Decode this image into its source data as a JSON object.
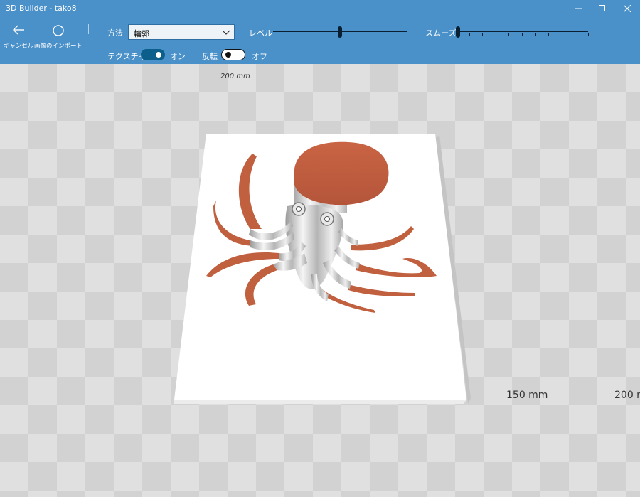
{
  "window": {
    "title": "3D Builder - tako8"
  },
  "toolbar": {
    "cancel": {
      "label": "キャンセル",
      "icon": "back-arrow-icon"
    },
    "import": {
      "label": "画像のインポート",
      "icon": "circle-icon"
    },
    "method": {
      "label": "方法",
      "value": "輪郭"
    },
    "level": {
      "label": "レベル",
      "value_fraction": 0.5
    },
    "smooth": {
      "label": "スムーズ",
      "value_fraction": 0.0
    },
    "texture": {
      "label": "テクスチャ",
      "state": "オン",
      "on": true
    },
    "invert": {
      "label": "反転",
      "state": "オフ",
      "on": false
    }
  },
  "viewport": {
    "dimensions": [
      "200 mm",
      "150 mm",
      "200 mm"
    ]
  },
  "colors": {
    "accent": "#4a90c9",
    "toggle_on": "#0b5f8a",
    "model": "#c0603f"
  }
}
